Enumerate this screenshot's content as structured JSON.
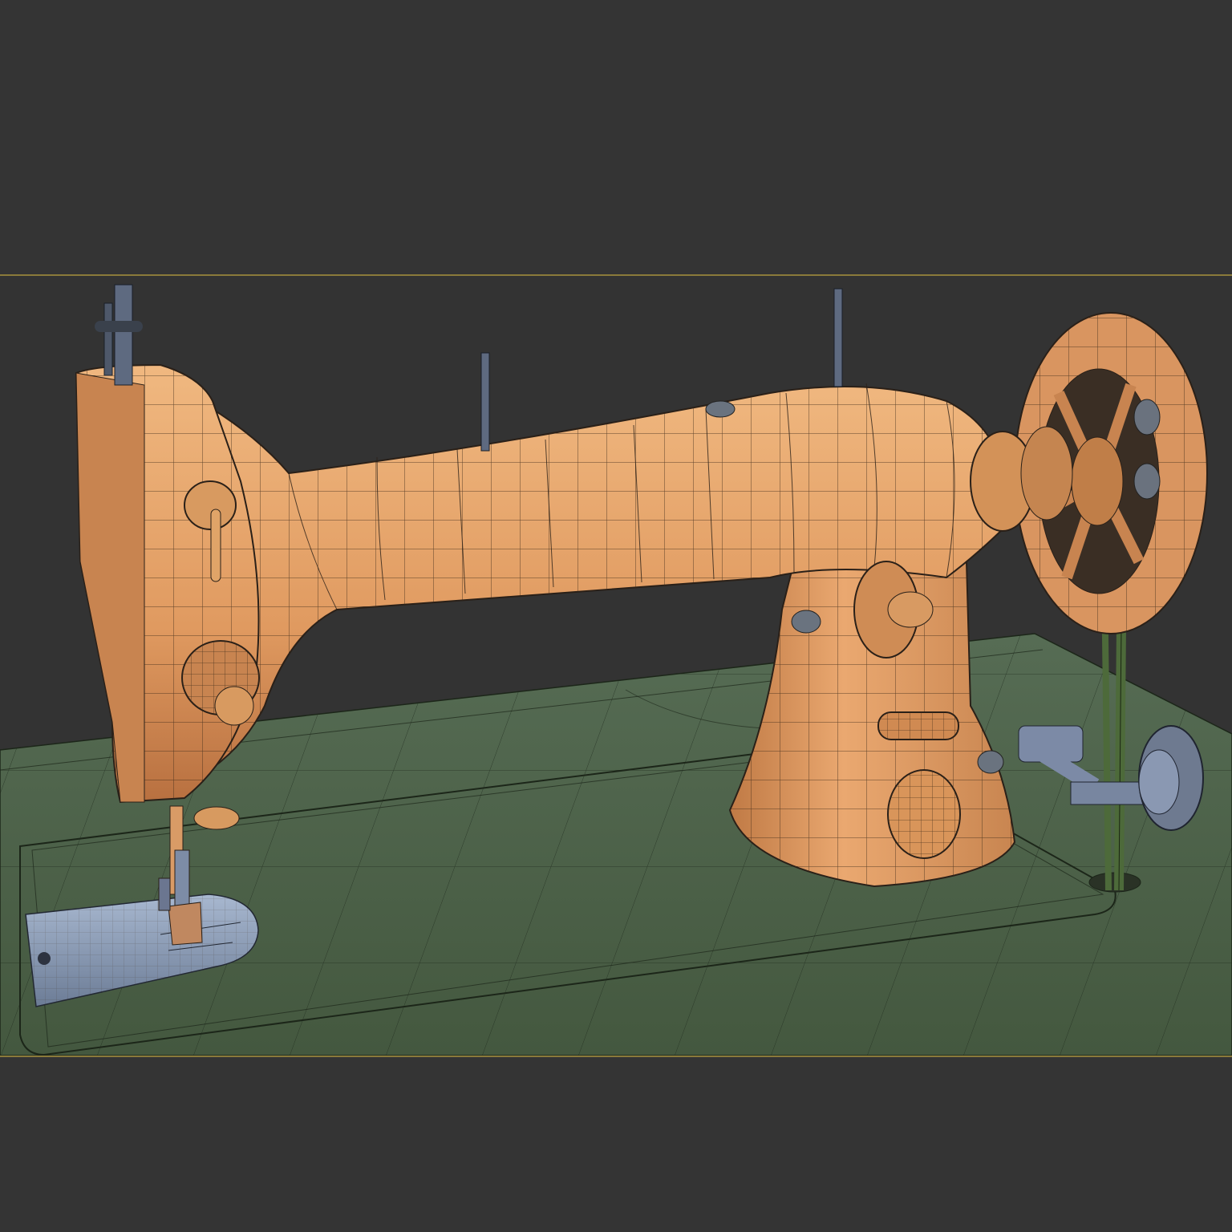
{
  "viewport": {
    "background_color": "#333333",
    "safe_frame_color": "#8a7a3a"
  },
  "scene": {
    "subject": "sewing-machine-wireframe-model",
    "colors": {
      "machine_body": "#e0a06a",
      "machine_body_shadow": "#b07040",
      "wire": "#2a2018",
      "table_top": "#4a5e48",
      "table_edge": "#3e5240",
      "metal_parts": "#8fa2bc",
      "dark_metal": "#5a6470",
      "belt": "#4f6a3c"
    }
  }
}
